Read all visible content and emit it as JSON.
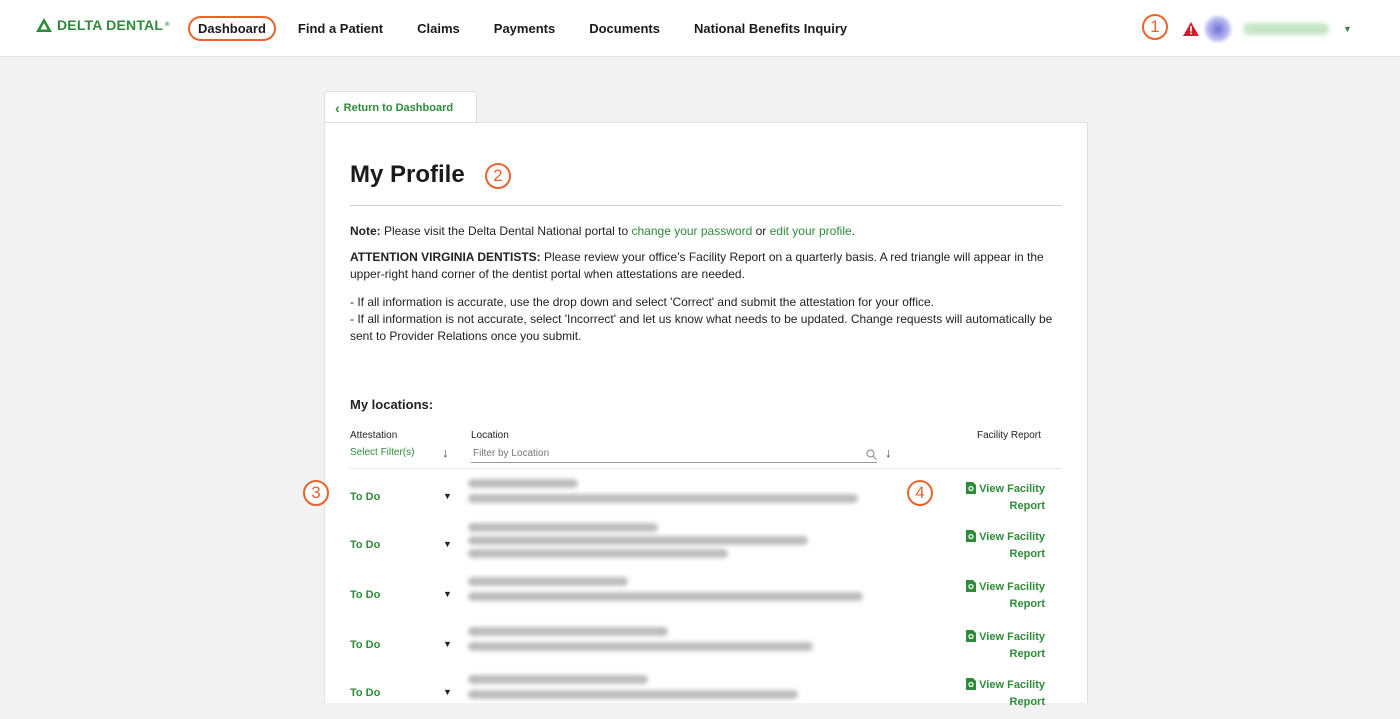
{
  "brand": {
    "name": "DELTA DENTAL",
    "color": "#2e8b3a",
    "accent": "#e8642c"
  },
  "nav": {
    "items": [
      {
        "label": "Dashboard",
        "active": true
      },
      {
        "label": "Find a Patient"
      },
      {
        "label": "Claims"
      },
      {
        "label": "Payments"
      },
      {
        "label": "Documents"
      },
      {
        "label": "National Benefits Inquiry"
      }
    ]
  },
  "callouts": [
    "1",
    "2",
    "3",
    "4"
  ],
  "header": {
    "warning_icon": "warning-triangle-icon"
  },
  "back_tab": {
    "label": "Return to Dashboard"
  },
  "page": {
    "title": "My Profile",
    "note_bold": "Note:",
    "note_text": "Please visit the Delta Dental National portal to",
    "note_link1": "change your password",
    "note_or": "or",
    "note_link2": "edit your profile",
    "note_end": ".",
    "attention_bold": "ATTENTION VIRGINIA DENTISTS:",
    "attention_text": "Please review your office's Facility Report on a quarterly basis. A red triangle will appear in the upper-right hand corner of the dentist portal when attestations are needed.",
    "bullet1": "- If all information is accurate, use the drop down and select 'Correct' and submit the attestation for your office.",
    "bullet2": "- If all information is not accurate, select 'Incorrect' and let us know what needs to be updated. Change requests will automatically be sent to Provider Relations once you submit."
  },
  "locations": {
    "title": "My locations:",
    "columns": {
      "attestation": "Attestation",
      "location": "Location",
      "facility_report": "Facility Report"
    },
    "select_filter": "Select Filter(s)",
    "filter_placeholder": "Filter by Location",
    "report_line1": "View Facility",
    "report_line2": "Report",
    "rows": [
      {
        "status": "To Do"
      },
      {
        "status": "To Do"
      },
      {
        "status": "To Do"
      },
      {
        "status": "To Do"
      },
      {
        "status": "To Do"
      }
    ]
  }
}
